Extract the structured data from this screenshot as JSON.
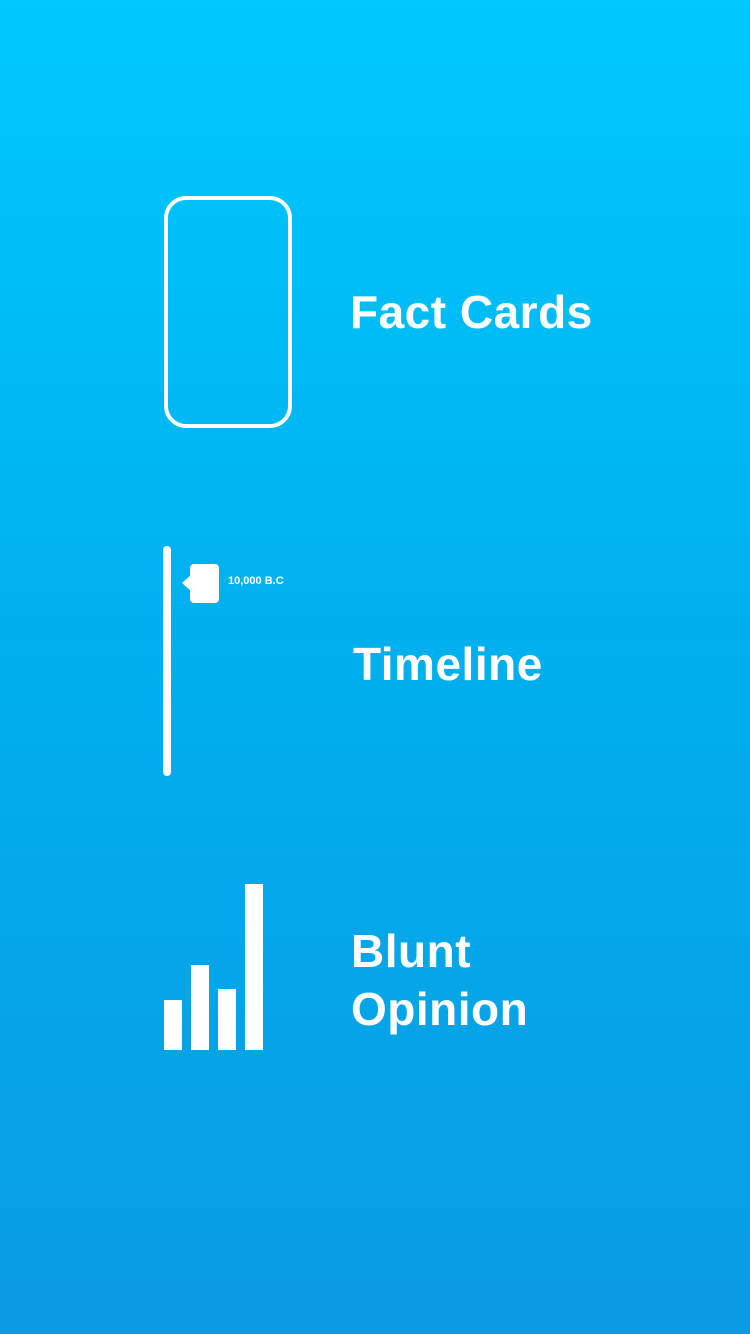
{
  "features": [
    {
      "id": "fact-cards",
      "label": "Fact Cards"
    },
    {
      "id": "timeline",
      "label": "Timeline",
      "marker_date": "10,000 B.C"
    },
    {
      "id": "blunt-opinion",
      "label_line_1": "Blunt",
      "label_line_2": "Opinion"
    }
  ],
  "bars_icon": {
    "levels": [
      0.3,
      0.51,
      0.37,
      1.0
    ]
  },
  "colors": {
    "background_top": "#00c9fd",
    "background_bottom": "#0a9be2",
    "foreground": "#ffffff"
  }
}
